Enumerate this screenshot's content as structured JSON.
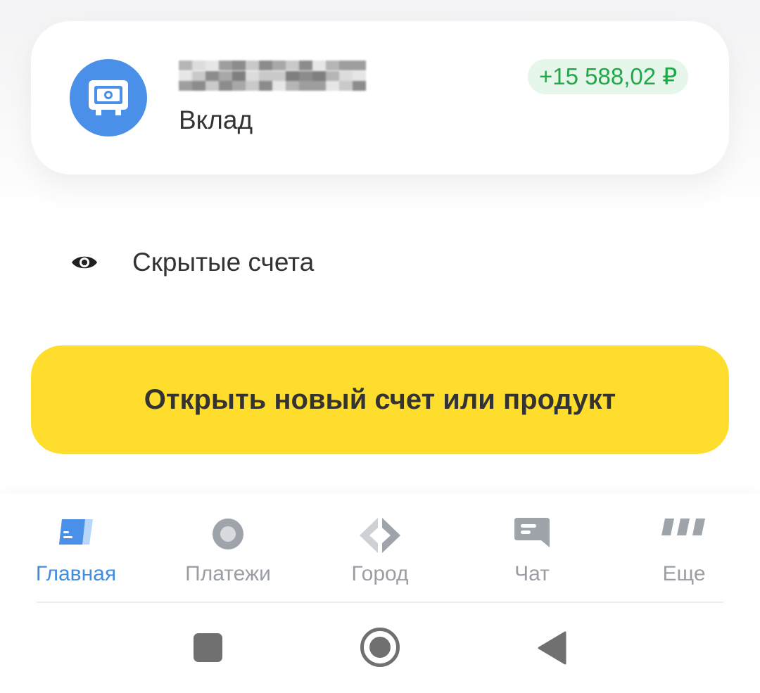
{
  "account": {
    "icon": "safe-icon",
    "name_hidden": "",
    "subtitle": "Вклад",
    "amount": "+15 588,02 ₽"
  },
  "hidden_accounts": {
    "icon": "eye-icon",
    "label": "Скрытые счета"
  },
  "open_product_button": {
    "label": "Открыть новый счет или продукт"
  },
  "tabbar": {
    "tabs": [
      {
        "label": "Главная",
        "icon": "home-card-icon",
        "active": true
      },
      {
        "label": "Платежи",
        "icon": "payments-circle-icon",
        "active": false
      },
      {
        "label": "Город",
        "icon": "city-diamond-icon",
        "active": false
      },
      {
        "label": "Чат",
        "icon": "chat-bubble-icon",
        "active": false
      },
      {
        "label": "Еще",
        "icon": "more-dots-icon",
        "active": false
      }
    ]
  },
  "system_nav": {
    "buttons": [
      "recents-square-icon",
      "home-circle-icon",
      "back-triangle-icon"
    ]
  },
  "colors": {
    "accent_yellow": "#ffdd2d",
    "active_blue": "#428bdd",
    "amount_green": "#1fa848",
    "icon_blue": "#4a90e8"
  }
}
